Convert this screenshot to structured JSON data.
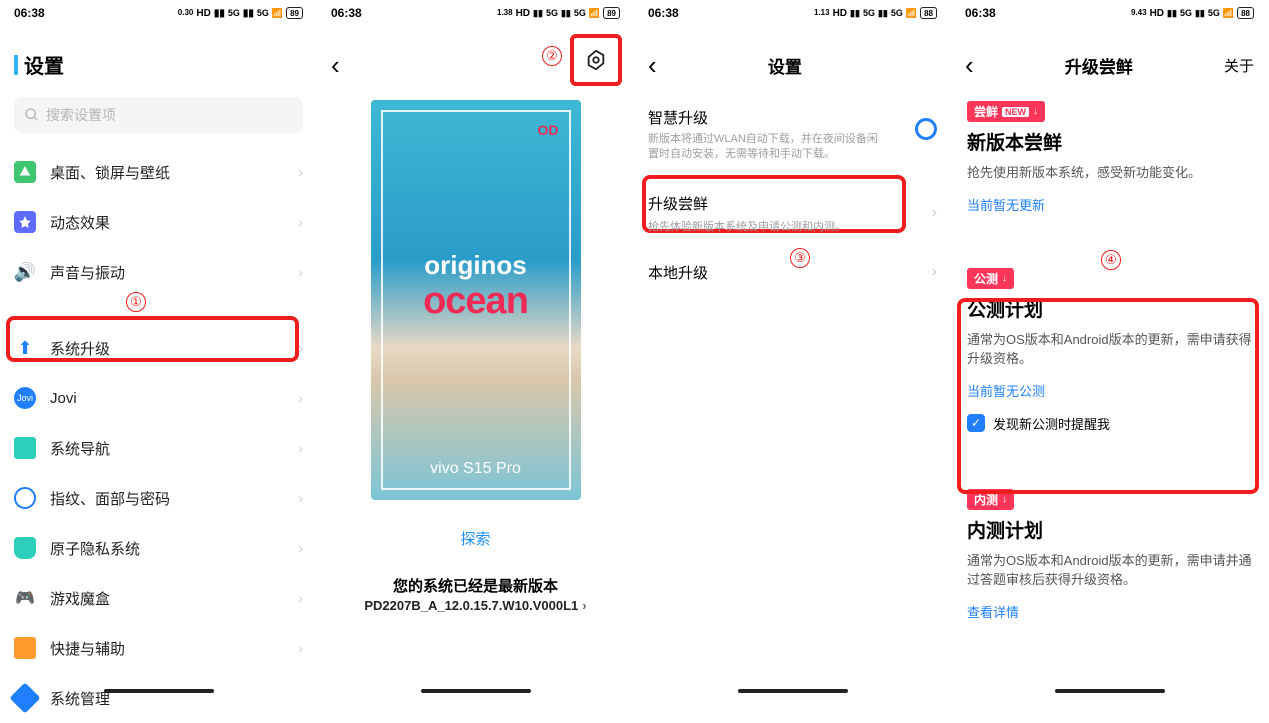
{
  "status": {
    "time": "06:38",
    "battery1": "89",
    "battery2": "89",
    "battery3": "88",
    "battery4": "88",
    "speed1": "0.30",
    "speed2": "1.38",
    "speed3": "1.13",
    "speed4": "9.43",
    "hd": "HD",
    "sig": "5G"
  },
  "p1": {
    "title": "设置",
    "search_ph": "搜索设置项",
    "items": [
      {
        "label": "桌面、锁屏与壁纸"
      },
      {
        "label": "动态效果"
      },
      {
        "label": "声音与振动"
      },
      {
        "label": "系统升级"
      },
      {
        "label": "Jovi"
      },
      {
        "label": "系统导航"
      },
      {
        "label": "指纹、面部与密码"
      },
      {
        "label": "原子隐私系统"
      },
      {
        "label": "游戏魔盒"
      },
      {
        "label": "快捷与辅助"
      },
      {
        "label": "系统管理"
      }
    ]
  },
  "p2": {
    "poster_od": "OD",
    "poster_t1": "originos",
    "poster_t2": "ocean",
    "poster_t3": "vivo S15 Pro",
    "explore": "探索",
    "latest": "您的系统已经是最新版本",
    "version": "PD2207B_A_12.0.15.7.W10.V000L1"
  },
  "p3": {
    "title": "设置",
    "smart_t": "智慧升级",
    "smart_d": "新版本将通过WLAN自动下载，并在夜间设备闲置时自动安装，无需等待和手动下载。",
    "early_t": "升级尝鲜",
    "early_d": "抢先体验新版本系统及申请公测和内测。",
    "local_t": "本地升级"
  },
  "p4": {
    "title": "升级尝鲜",
    "about": "关于",
    "badge_fresh": "尝鲜",
    "badge_new": "NEW",
    "fresh_h": "新版本尝鲜",
    "fresh_d": "抢先使用新版本系统，感受新功能变化。",
    "fresh_link": "当前暂无更新",
    "badge_beta": "公测",
    "beta_h": "公测计划",
    "beta_d": "通常为OS版本和Android版本的更新，需申请获得升级资格。",
    "beta_link": "当前暂无公测",
    "beta_chk": "发现新公测时提醒我",
    "badge_alpha": "内测",
    "alpha_h": "内测计划",
    "alpha_d": "通常为OS版本和Android版本的更新，需申请并通过答题审核后获得升级资格。",
    "alpha_link": "查看详情"
  },
  "anno": {
    "a1": "①",
    "a2": "②",
    "a3": "③",
    "a4": "④"
  }
}
